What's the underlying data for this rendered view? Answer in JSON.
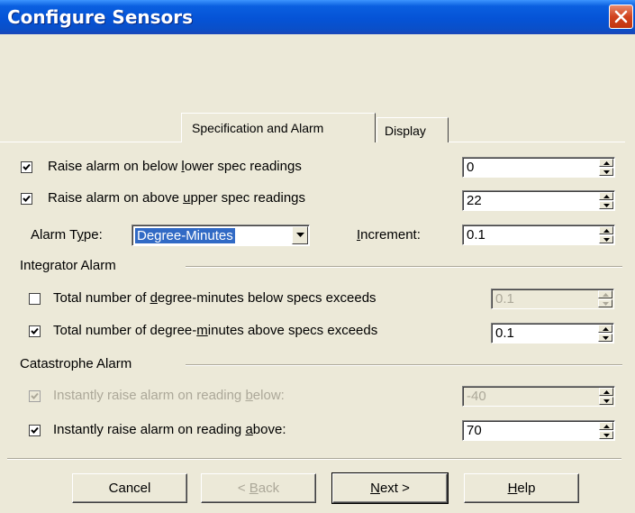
{
  "window": {
    "title": "Configure Sensors",
    "close_icon": "close-icon"
  },
  "tabs": [
    {
      "label": "Specification and Alarm",
      "active": true
    },
    {
      "label": "Display",
      "active": false
    }
  ],
  "spec": {
    "lower": {
      "pre": "Raise alarm on below ",
      "key": "l",
      "post": "ower spec readings",
      "checked": true,
      "value": "0"
    },
    "upper": {
      "pre": "Raise alarm on above ",
      "key": "u",
      "post": "pper spec readings",
      "checked": true,
      "value": "22"
    },
    "alarm_type": {
      "pre": "Alarm T",
      "key": "y",
      "post": "pe:",
      "value": "Degree-Minutes"
    },
    "increment": {
      "key": "I",
      "post": "ncrement:",
      "value": "0.1"
    }
  },
  "integrator": {
    "heading": "Integrator Alarm",
    "below": {
      "pre": "Total number of ",
      "key": "d",
      "post": "egree-minutes below specs exceeds",
      "checked": false,
      "enabled": false,
      "value": "0.1"
    },
    "above": {
      "pre": "Total number of degree-",
      "key": "m",
      "post": "inutes above specs exceeds",
      "checked": true,
      "enabled": true,
      "value": "0.1"
    }
  },
  "catastrophe": {
    "heading": "Catastrophe Alarm",
    "below": {
      "pre": "Instantly raise alarm on reading ",
      "key": "b",
      "post": "elow:",
      "checked": true,
      "enabled": false,
      "value": "-40"
    },
    "above": {
      "pre": "Instantly raise alarm on reading ",
      "key": "a",
      "post": "bove:",
      "checked": true,
      "enabled": true,
      "value": "70"
    }
  },
  "buttons": {
    "cancel": "Cancel",
    "back": {
      "pre": "< ",
      "key": "B",
      "post": "ack"
    },
    "next": {
      "key": "N",
      "post": "ext >"
    },
    "help": {
      "key": "H",
      "post": "elp"
    }
  },
  "colors": {
    "title_bar": "#0553d6",
    "dialog_bg": "#ece9d8",
    "selection": "#316ac5",
    "close_button": "#d0431f"
  }
}
